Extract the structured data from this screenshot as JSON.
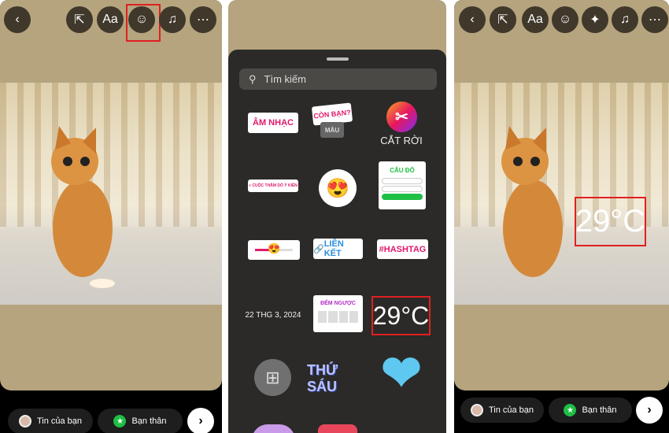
{
  "left_panel": {
    "toolbar": [
      "back",
      "expand",
      "text",
      "sticker",
      "music",
      "more"
    ],
    "text_label": "Aa",
    "bottom": {
      "your_story": "Tin của bạn",
      "close_friends": "Bạn thân"
    }
  },
  "middle_panel": {
    "search_placeholder": "Tìm kiếm",
    "stickers": {
      "music": "ÂM NHẠC",
      "add_yours": "CÒN BẠN?",
      "template": "MẪU",
      "cutout": "CẮT RỜI",
      "poll": "≡ CUỘC THĂM DÒ Ý KIẾN",
      "quiz": "CÂU ĐỐ",
      "link": "LIÊN KẾT",
      "hashtag": "#HASHTAG",
      "date": "22 THG 3, 2024",
      "countdown": "ĐẾM NGƯỢC",
      "temperature": "29°C",
      "weekday": "THỨ SÁU"
    }
  },
  "right_panel": {
    "toolbar": [
      "back",
      "expand",
      "text",
      "sticker",
      "effects",
      "music",
      "more"
    ],
    "text_label": "Aa",
    "temperature_sticker": "29°C",
    "bottom": {
      "your_story": "Tin của bạn",
      "close_friends": "Bạn thân"
    }
  },
  "colors": {
    "story_bg": "#b5a47e",
    "toolbar_button": "#3f382b",
    "highlight": "#e02020",
    "sheet": "#2b2a28",
    "pink": "#e0186c",
    "green": "#1fbf45"
  }
}
